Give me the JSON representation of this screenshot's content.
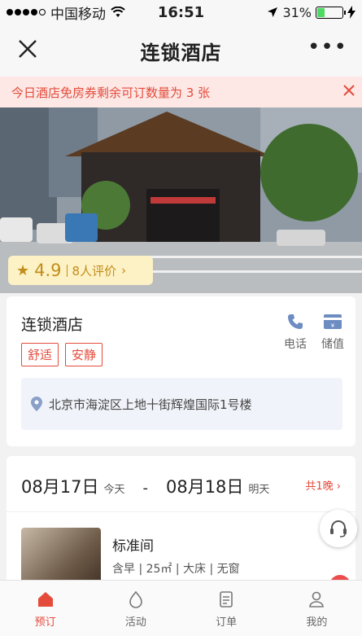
{
  "status_bar": {
    "carrier": "中国移动",
    "time": "16:51",
    "battery": "31%",
    "battery_level": 0.31
  },
  "navbar": {
    "title": "连锁酒店",
    "close_icon": "close-icon",
    "more_icon": "more-icon"
  },
  "notice": {
    "text": "今日酒店免房券剩余可订数量为 3 张",
    "close_icon": "close-icon"
  },
  "rating": {
    "score": "4.9",
    "reviews": "8人评价"
  },
  "hotel": {
    "name": "连锁酒店",
    "tags": [
      "舒适",
      "安静"
    ],
    "actions": [
      {
        "label": "电话",
        "icon": "phone-icon"
      },
      {
        "label": "储值",
        "icon": "wallet-icon"
      }
    ],
    "address": "北京市海淀区上地十街辉煌国际1号楼"
  },
  "booking": {
    "check_in": "08月17日",
    "check_in_sub": "今天",
    "separator": "-",
    "check_out": "08月18日",
    "check_out_sub": "明天",
    "nights": "共1晚"
  },
  "room": {
    "name": "标准间",
    "info": "含早 | 25㎡ | 大床 | 无窗"
  },
  "tabs": [
    {
      "label": "预订",
      "icon": "home-icon",
      "active": true
    },
    {
      "label": "活动",
      "icon": "activity-icon",
      "active": false
    },
    {
      "label": "订单",
      "icon": "order-icon",
      "active": false
    },
    {
      "label": "我的",
      "icon": "user-icon",
      "active": false
    }
  ],
  "colors": {
    "accent": "#e44b3b",
    "rating": "#c28d1a",
    "rating_bg": "#fdf2c6",
    "notice_bg": "#fde8e6"
  }
}
